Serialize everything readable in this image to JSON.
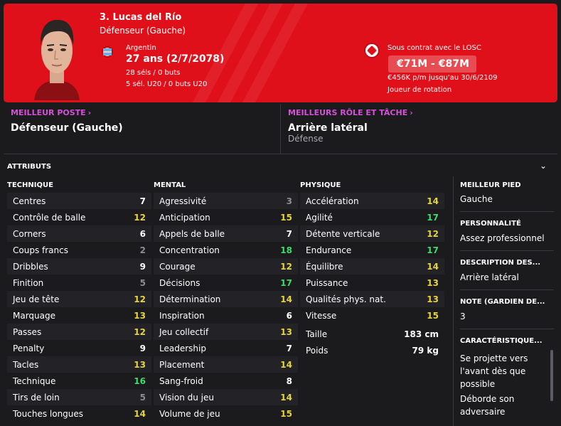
{
  "player": {
    "name": "3. Lucas del Río",
    "position": "Défenseur (Gauche)",
    "nationality": "Argentin",
    "age": "27 ans (2/7/2078)",
    "caps": "28 séls / 0 buts",
    "u20_caps": "5 sél. U20 / 0 buts U20",
    "contract": "Sous contrat avec le LOSC",
    "value": "€71M - €87M",
    "wage": "€456K p/m jusqu'au 30/6/2109",
    "squad_status": "Joueur de rotation"
  },
  "best_position": {
    "label": "MEILLEUR POSTE",
    "value": "Défenseur (Gauche)"
  },
  "best_role": {
    "label": "MEILLEURS RÔLE ET TÂCHE",
    "value": "Arrière latéral",
    "duty": "Défense"
  },
  "attributes": {
    "title": "ATTRIBUTS",
    "technique": {
      "header": "TECHNIQUE",
      "items": [
        {
          "label": "Centres",
          "value": "7",
          "color": "white"
        },
        {
          "label": "Contrôle de balle",
          "value": "12",
          "color": "yellow"
        },
        {
          "label": "Corners",
          "value": "6",
          "color": "white"
        },
        {
          "label": "Coups francs",
          "value": "2",
          "color": "grey"
        },
        {
          "label": "Dribbles",
          "value": "9",
          "color": "white"
        },
        {
          "label": "Finition",
          "value": "5",
          "color": "grey"
        },
        {
          "label": "Jeu de tête",
          "value": "12",
          "color": "yellow"
        },
        {
          "label": "Marquage",
          "value": "13",
          "color": "yellow"
        },
        {
          "label": "Passes",
          "value": "12",
          "color": "yellow"
        },
        {
          "label": "Penalty",
          "value": "9",
          "color": "white"
        },
        {
          "label": "Tacles",
          "value": "13",
          "color": "yellow"
        },
        {
          "label": "Technique",
          "value": "16",
          "color": "green"
        },
        {
          "label": "Tirs de loin",
          "value": "5",
          "color": "grey"
        },
        {
          "label": "Touches longues",
          "value": "14",
          "color": "yellow"
        }
      ]
    },
    "mental": {
      "header": "MENTAL",
      "items": [
        {
          "label": "Agressivité",
          "value": "3",
          "color": "grey"
        },
        {
          "label": "Anticipation",
          "value": "15",
          "color": "yellow"
        },
        {
          "label": "Appels de balle",
          "value": "7",
          "color": "white"
        },
        {
          "label": "Concentration",
          "value": "18",
          "color": "green"
        },
        {
          "label": "Courage",
          "value": "12",
          "color": "yellow"
        },
        {
          "label": "Décisions",
          "value": "17",
          "color": "green"
        },
        {
          "label": "Détermination",
          "value": "14",
          "color": "yellow"
        },
        {
          "label": "Inspiration",
          "value": "6",
          "color": "white"
        },
        {
          "label": "Jeu collectif",
          "value": "13",
          "color": "yellow"
        },
        {
          "label": "Leadership",
          "value": "7",
          "color": "white"
        },
        {
          "label": "Placement",
          "value": "14",
          "color": "yellow"
        },
        {
          "label": "Sang-froid",
          "value": "8",
          "color": "white"
        },
        {
          "label": "Vision du jeu",
          "value": "14",
          "color": "yellow"
        },
        {
          "label": "Volume de jeu",
          "value": "15",
          "color": "yellow"
        }
      ]
    },
    "physique": {
      "header": "PHYSIQUE",
      "items": [
        {
          "label": "Accélération",
          "value": "14",
          "color": "yellow"
        },
        {
          "label": "Agilité",
          "value": "17",
          "color": "green"
        },
        {
          "label": "Détente verticale",
          "value": "12",
          "color": "yellow"
        },
        {
          "label": "Endurance",
          "value": "17",
          "color": "green"
        },
        {
          "label": "Équilibre",
          "value": "14",
          "color": "yellow"
        },
        {
          "label": "Puissance",
          "value": "13",
          "color": "yellow"
        },
        {
          "label": "Qualités phys. nat.",
          "value": "13",
          "color": "yellow"
        },
        {
          "label": "Vitesse",
          "value": "15",
          "color": "yellow"
        }
      ],
      "height_label": "Taille",
      "height": "183 cm",
      "weight_label": "Poids",
      "weight": "79 kg"
    }
  },
  "side": {
    "foot_label": "MEILLEUR PIED",
    "foot": "Gauche",
    "personality_label": "PERSONNALITÉ",
    "personality": "Assez professionnel",
    "description_label": "DESCRIPTION DES...",
    "description": "Arrière latéral",
    "gk_label": "NOTE (GARDIEN DE...",
    "gk": "3",
    "traits_label": "CARACTÉRISTIQUE...",
    "trait1": "Se projette vers l'avant dès que possible",
    "trait2": "Déborde son adversaire"
  },
  "colors": {
    "header_red": "#e0101a",
    "accent_pink": "#d64fd9",
    "grey": "#8c8c92",
    "yellow": "#e5d43b",
    "green": "#3ddb69"
  },
  "icons": {
    "collapse": "chevron-down-icon",
    "nav": "chevron-right-icon",
    "nation": "argentina-flag-icon",
    "club": "losc-badge-icon",
    "portrait": "player-portrait"
  }
}
